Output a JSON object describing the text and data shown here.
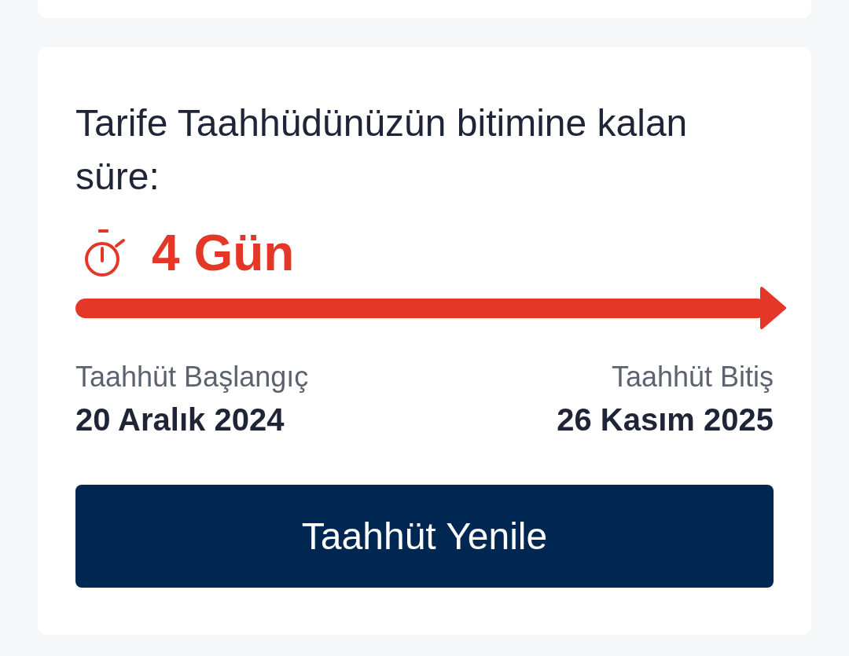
{
  "commitment": {
    "title": "Tarife Taahhüdünüzün bitimine kalan süre:",
    "remaining": "4 Gün",
    "start": {
      "label": "Taahhüt Başlangıç",
      "date": "20 Aralık 2024"
    },
    "end": {
      "label": "Taahhüt Bitiş",
      "date": "26 Kasım 2025"
    },
    "button": "Taahhüt Yenile"
  }
}
